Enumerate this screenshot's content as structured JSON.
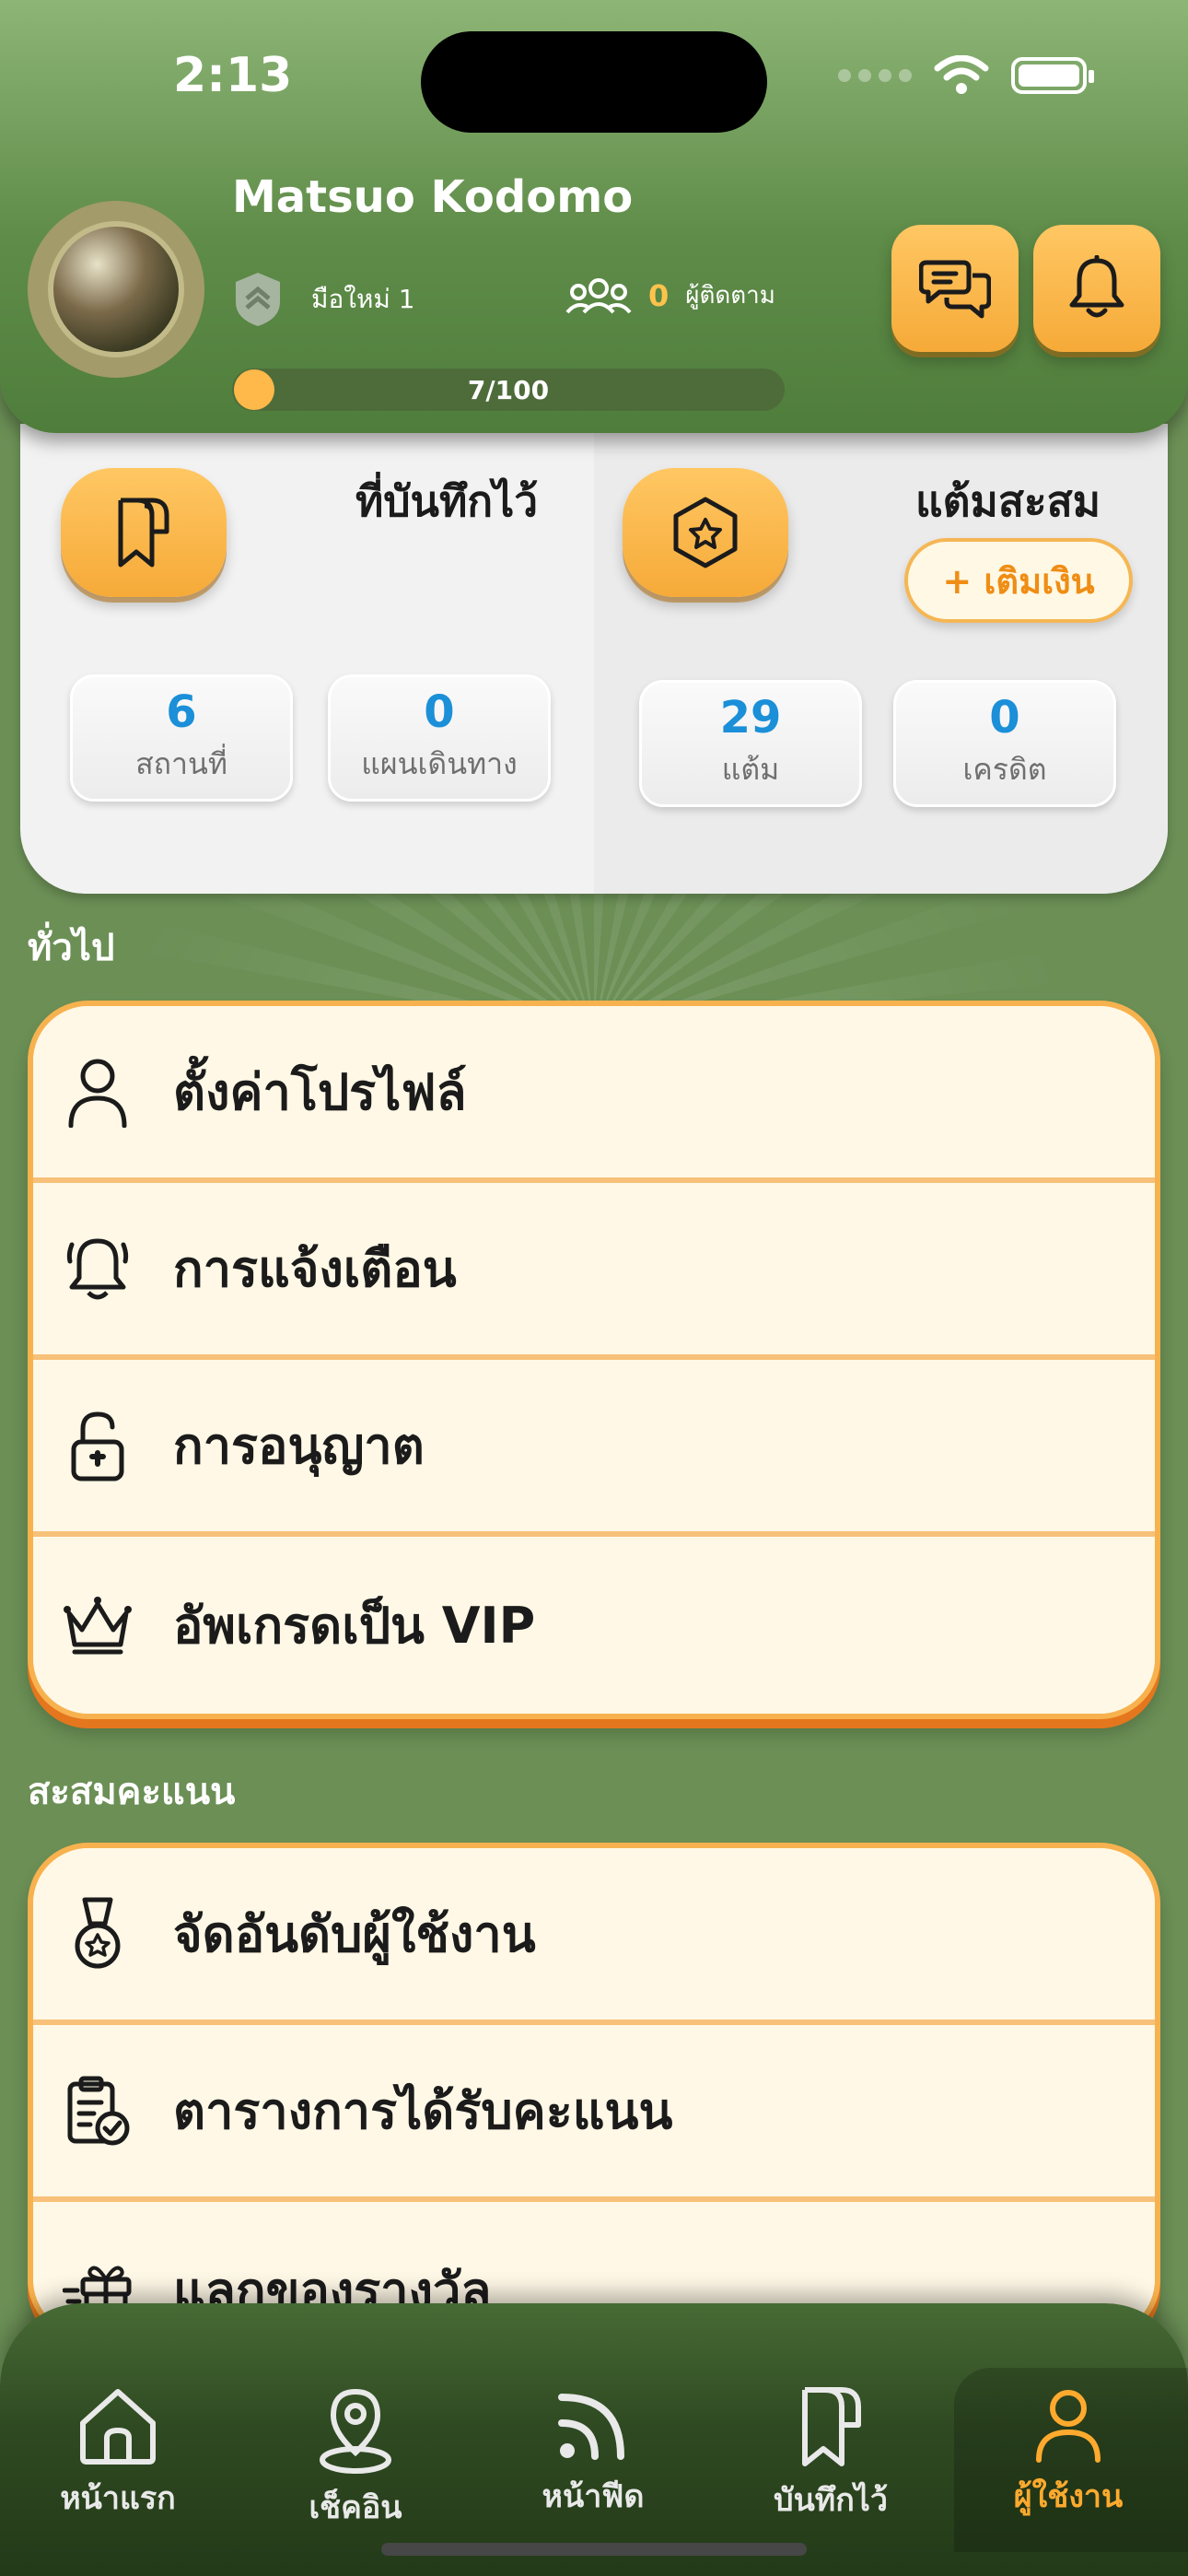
{
  "status_bar": {
    "time": "2:13"
  },
  "profile": {
    "name": "Matsuo Kodomo",
    "rank": "มือใหม่ 1",
    "followers_count": "0",
    "followers_label": "ผู้ติดตาม",
    "xp_text": "7/100",
    "xp_progress": 0.07
  },
  "saved": {
    "title": "ที่บันทึกไว้",
    "places_value": "6",
    "places_label": "สถานที่",
    "plans_value": "0",
    "plans_label": "แผนเดินทาง"
  },
  "points": {
    "title": "แต้มสะสม",
    "topup_label": "+ เติมเงิน",
    "points_value": "29",
    "points_label": "แต้ม",
    "credit_value": "0",
    "credit_label": "เครดิต"
  },
  "general": {
    "title": "ทั่วไป",
    "items": [
      {
        "label": "ตั้งค่าโปรไฟล์",
        "icon": "user-icon"
      },
      {
        "label": "การแจ้งเตือน",
        "icon": "bell-icon"
      },
      {
        "label": "การอนุญาต",
        "icon": "unlock-icon"
      },
      {
        "label": "อัพเกรดเป็น VIP",
        "icon": "crown-icon"
      }
    ]
  },
  "rewards": {
    "title": "สะสมคะแนน",
    "items": [
      {
        "label": "จัดอันดับผู้ใช้งาน",
        "icon": "medal-icon"
      },
      {
        "label": "ตารางการได้รับคะแนน",
        "icon": "clipboard-check-icon"
      },
      {
        "label": "แลกของรางวัล",
        "icon": "gift-icon"
      }
    ]
  },
  "nav": {
    "items": [
      {
        "label": "หน้าแรก",
        "icon": "home-icon"
      },
      {
        "label": "เช็คอิน",
        "icon": "map-pin-icon"
      },
      {
        "label": "หน้าฟีด",
        "icon": "feed-icon"
      },
      {
        "label": "บันทึกไว้",
        "icon": "bookmark-icon"
      },
      {
        "label": "ผู้ใช้งาน",
        "icon": "user-icon"
      }
    ],
    "active": "ผู้ใช้งาน"
  },
  "colors": {
    "accent_orange": "#f6aa38",
    "header_green": "#5f8c49",
    "value_blue": "#1b8fd8",
    "active_nav": "#ffaa2e"
  }
}
